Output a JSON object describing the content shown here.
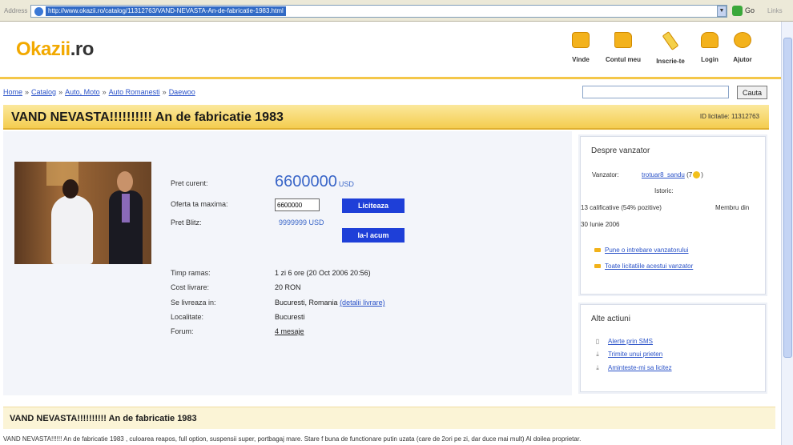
{
  "browser": {
    "address_label": "Address",
    "url": "http://www.okazii.ro/catalog/11312763/VAND-NEVASTA-An-de-fabricatie-1983.html",
    "go_label": "Go",
    "links_label": "Links"
  },
  "header": {
    "logo_part1": "Okazii",
    "logo_part2": ".ro",
    "nav": [
      {
        "label": "Vinde",
        "icon": "sell-icon"
      },
      {
        "label": "Contul meu",
        "icon": "folder-icon"
      },
      {
        "label": "Inscrie-te",
        "icon": "pencil-icon"
      },
      {
        "label": "Login",
        "icon": "lock-icon"
      },
      {
        "label": "Ajutor",
        "icon": "help-icon"
      }
    ]
  },
  "breadcrumb": [
    "Home",
    "Catalog",
    "Auto, Moto",
    "Auto Romanesti",
    "Daewoo"
  ],
  "breadcrumb_sep": "»",
  "search": {
    "button_label": "Cauta",
    "value": ""
  },
  "listing": {
    "title": "VAND NEVASTA!!!!!!!!!! An de fabricatie 1983",
    "id_label": "ID licitatie:",
    "id_value": "11312763",
    "current_price_label": "Pret curent:",
    "current_price": "6600000",
    "currency": "USD",
    "max_offer_label": "Oferta ta maxima:",
    "max_offer_value": "6600000",
    "bid_button": "Liciteaza",
    "blitz_label": "Pret Blitz:",
    "blitz_price": "9999999 USD",
    "buy_now_button": "Ia-l acum",
    "details": [
      {
        "label": "Timp ramas:",
        "value": "1 zi 6 ore (20 Oct 2006 20:56)",
        "link": ""
      },
      {
        "label": "Cost livrare:",
        "value": "20 RON",
        "link": ""
      },
      {
        "label": "Se livreaza in:",
        "value": "Bucuresti, Romania",
        "link": "(detalii livrare)"
      },
      {
        "label": "Localitate:",
        "value": "Bucuresti",
        "link": ""
      },
      {
        "label": "Forum:",
        "value": "",
        "link": "4 mesaje"
      }
    ]
  },
  "seller": {
    "title": "Despre vanzator",
    "seller_label": "Vanzator:",
    "seller_name": "trotuar8_sandu",
    "seller_score": "(7",
    "seller_score_close": ")",
    "ratings_label": "Istoric:",
    "ratings": "13 calificative (54% pozitive)",
    "member_since_label": "Membru din",
    "member_since_date": "30 Iunie 2006",
    "links": [
      "Pune o intrebare vanzatorului",
      "Toate licitatiile acestui vanzator"
    ]
  },
  "actions": {
    "title": "Alte actiuni",
    "links": [
      "Alerte prin SMS",
      "Trimite unui prieten",
      "Aminteste-mi sa licitez"
    ]
  },
  "description": {
    "title": "VAND NEVASTA!!!!!!!!!! An de fabricatie 1983",
    "text": "VAND NEVASTA!!!!!! An de fabricatie 1983 , culoarea reapos, full option, suspensii super, portbagaj mare. Stare f buna de functionare putin uzata (care de 2ori pe zi, dar duce mai mult) Al doilea proprietar."
  },
  "colors": {
    "accent": "#f4cd50",
    "link": "#2a52c8",
    "price": "#3a66c8",
    "button": "#1e3fd8"
  }
}
